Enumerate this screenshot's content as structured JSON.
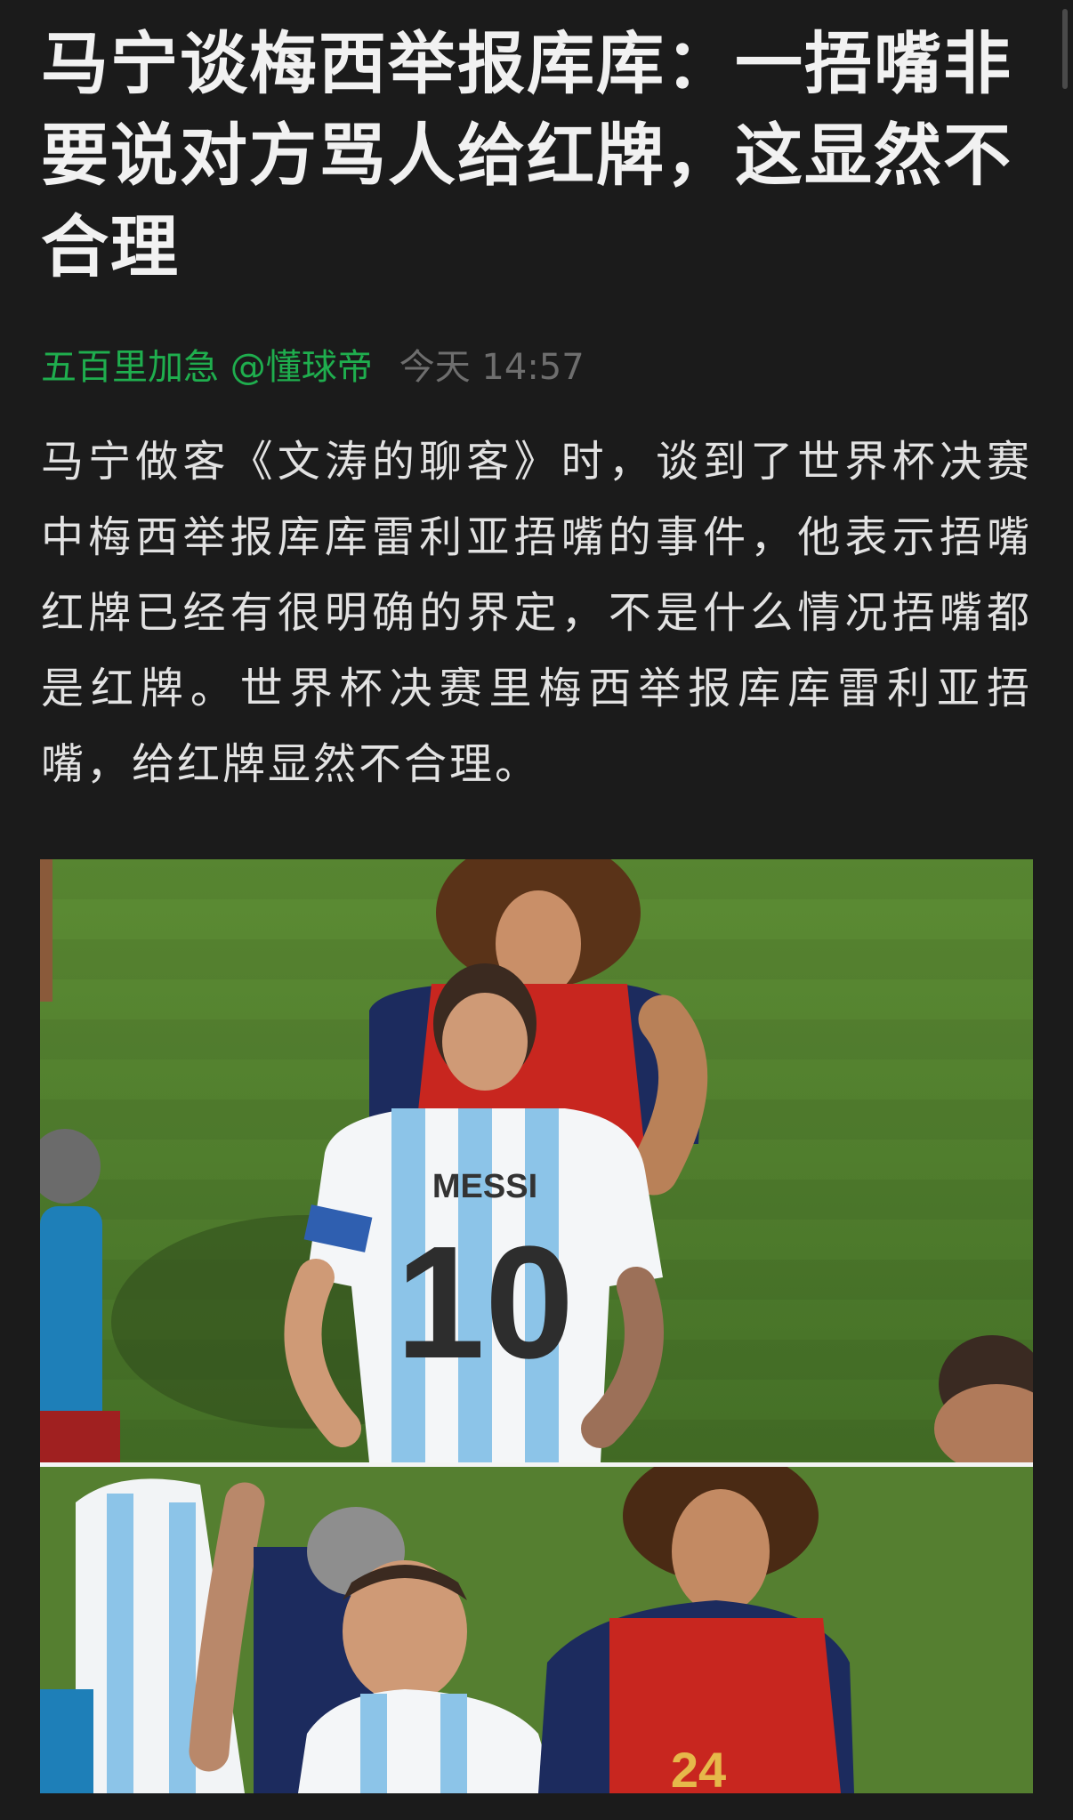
{
  "article": {
    "title": "马宁谈梅西举报库库：一捂嘴非要说对方骂人给红牌，这显然不合理",
    "author": "五百里加急 @懂球帝",
    "timestamp": "今天 14:57",
    "body": "马宁做客《文涛的聊客》时，谈到了世界杯决赛中梅西举报库库雷利亚捂嘴的事件，他表示捂嘴红牌已经有很明确的界定，不是什么情况捂嘴都是红牌。世界杯决赛里梅西举报库库雷利亚捂嘴，给红牌显然不合理。"
  },
  "images": {
    "top_jersey_name": "MESSI",
    "top_jersey_number": "10",
    "bottom_jersey_number": "24"
  },
  "colors": {
    "background": "#1b1b1b",
    "author_green": "#1fae4e",
    "timestamp_gray": "#6e6e6e",
    "pitch_green": "#4f7d2c",
    "argentina_blue": "#8cc4e8",
    "spain_red": "#c8261f"
  }
}
